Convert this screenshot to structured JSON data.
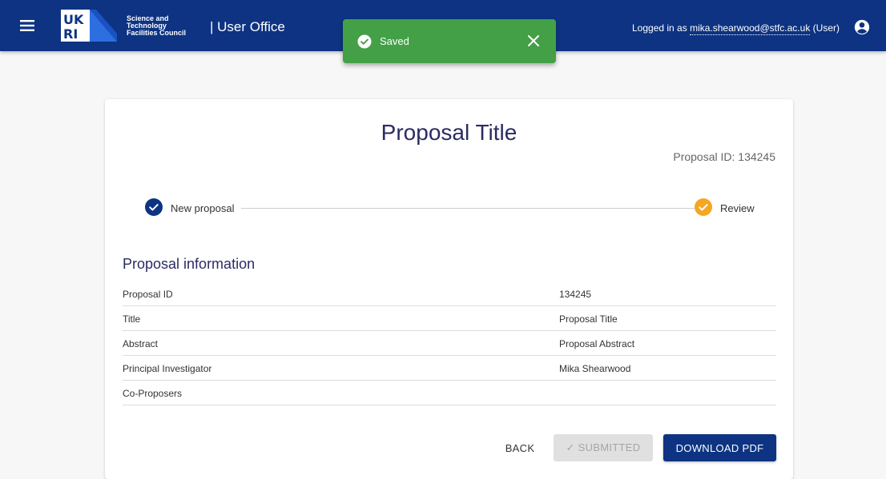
{
  "header": {
    "org_lines": [
      "Science and",
      "Technology",
      "Facilities Council"
    ],
    "app_title": "| User Office",
    "logged_in_prefix": "Logged in as",
    "user_email": "mika.shearwood@stfc.ac.uk",
    "user_role": "(User)",
    "colors": {
      "bar": "#0d3382",
      "text": "#ffffff"
    }
  },
  "toast": {
    "message": "Saved",
    "color": "#43a047"
  },
  "proposal": {
    "title": "Proposal Title",
    "id_label": "Proposal ID: 134245",
    "steps": [
      {
        "label": "New proposal",
        "status": "complete",
        "color": "#0d3382"
      },
      {
        "label": "Review",
        "status": "complete",
        "color": "#f5a623"
      }
    ],
    "section_title": "Proposal information",
    "rows": [
      {
        "key": "Proposal ID",
        "value": "134245"
      },
      {
        "key": "Title",
        "value": "Proposal Title"
      },
      {
        "key": "Abstract",
        "value": "Proposal Abstract"
      },
      {
        "key": "Principal Investigator",
        "value": "Mika Shearwood"
      },
      {
        "key": "Co-Proposers",
        "value": ""
      }
    ],
    "buttons": {
      "back": "BACK",
      "submitted": "✓ SUBMITTED",
      "download": "DOWNLOAD PDF"
    }
  }
}
